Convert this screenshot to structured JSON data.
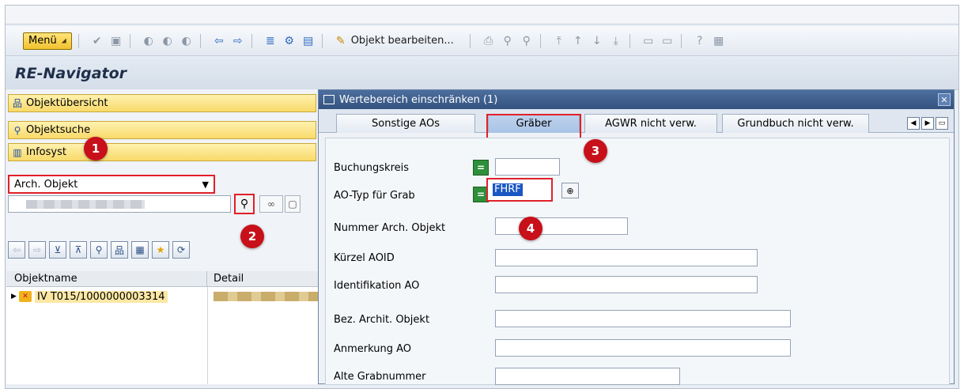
{
  "toolbar": {
    "menu_label": "Menü",
    "edit_object_label": "Objekt bearbeiten..."
  },
  "title": "RE-Navigator",
  "navigator": {
    "nav_buttons": [
      {
        "label": "Objektübersicht",
        "icon": "hierarchy-icon"
      },
      {
        "label": "Objektsuche",
        "icon": "binoculars-icon"
      },
      {
        "label": "Infosyst",
        "icon": "infosystem-icon"
      }
    ],
    "object_type_select": "Arch. Objekt",
    "tree_columns": [
      "Objektname",
      "Detail"
    ],
    "tree_rows": [
      {
        "name": "IV T015/1000000003314"
      }
    ]
  },
  "dialog": {
    "title": "Wertebereich einschränken (1)",
    "tabs": [
      "Sonstige AOs",
      "Gräber",
      "AGWR nicht verw.",
      "Grundbuch nicht verw."
    ],
    "active_tab": "Gräber",
    "fields": {
      "buchungskreis": {
        "label": "Buchungskreis",
        "value": ""
      },
      "ao_typ": {
        "label": "AO-Typ für Grab",
        "value": "FHRF"
      },
      "nummer": {
        "label": "Nummer Arch. Objekt",
        "value": ""
      },
      "kuerzel": {
        "label": "Kürzel AOID",
        "value": ""
      },
      "identifikation": {
        "label": "Identifikation AO",
        "value": ""
      },
      "bezeichnung": {
        "label": "Bez. Archit. Objekt",
        "value": ""
      },
      "anmerkung": {
        "label": "Anmerkung AO",
        "value": ""
      },
      "alte_grabnummer": {
        "label": "Alte Grabnummer",
        "value": ""
      }
    }
  },
  "markers": [
    "1",
    "2",
    "3",
    "4"
  ],
  "colors": {
    "highlight_red": "#e0202a",
    "marker_red": "#c8101a",
    "nav_yellow": "#f8d96a",
    "dialog_title_blue": "#34527f"
  }
}
